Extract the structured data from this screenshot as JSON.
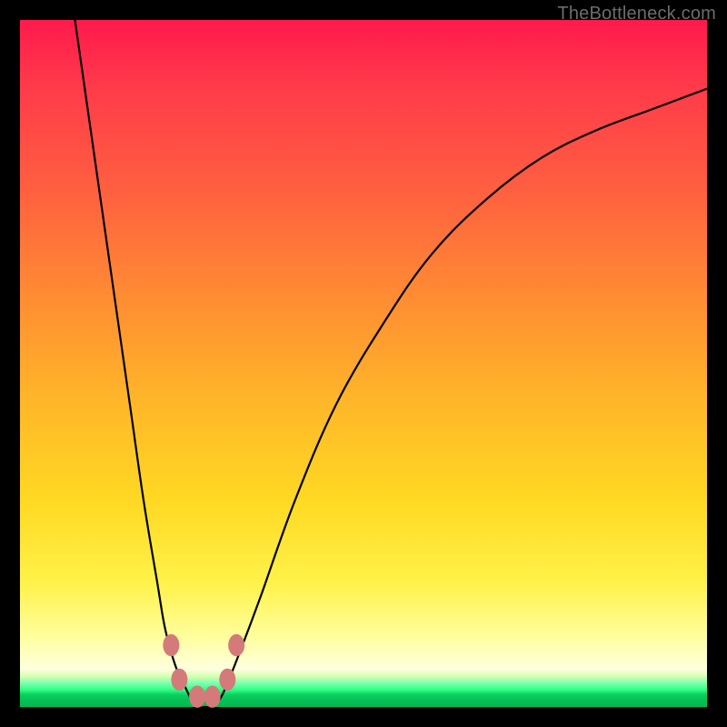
{
  "watermark": "TheBottleneck.com",
  "chart_data": {
    "type": "line",
    "title": "",
    "xlabel": "",
    "ylabel": "",
    "xlim": [
      0,
      100
    ],
    "ylim": [
      0,
      100
    ],
    "grid": false,
    "legend": false,
    "background": "rainbow-gradient-red-to-green-vertical",
    "series": [
      {
        "name": "bottleneck-curve",
        "x": [
          8,
          10,
          13,
          16,
          18,
          20,
          21,
          22,
          23,
          24,
          25,
          26,
          27,
          28,
          29,
          30,
          32,
          35,
          40,
          46,
          53,
          60,
          68,
          76,
          84,
          92,
          100
        ],
        "values": [
          100,
          86,
          65,
          44,
          30,
          18,
          12,
          8,
          5,
          3,
          1,
          0,
          0,
          0,
          1,
          3,
          8,
          16,
          30,
          44,
          56,
          66,
          74,
          80,
          84,
          87,
          90
        ]
      }
    ],
    "markers": [
      {
        "name": "dot-left-upper",
        "x": 22.0,
        "y": 9.0,
        "color": "#d47a7a",
        "r": 9
      },
      {
        "name": "dot-left-lower",
        "x": 23.2,
        "y": 4.0,
        "color": "#d47a7a",
        "r": 9
      },
      {
        "name": "dot-bottom-left",
        "x": 25.8,
        "y": 1.5,
        "color": "#d47a7a",
        "r": 9
      },
      {
        "name": "dot-bottom-right",
        "x": 28.0,
        "y": 1.5,
        "color": "#d47a7a",
        "r": 9
      },
      {
        "name": "dot-right-lower",
        "x": 30.2,
        "y": 4.0,
        "color": "#d47a7a",
        "r": 9
      },
      {
        "name": "dot-right-upper",
        "x": 31.5,
        "y": 9.0,
        "color": "#d47a7a",
        "r": 9
      }
    ]
  }
}
